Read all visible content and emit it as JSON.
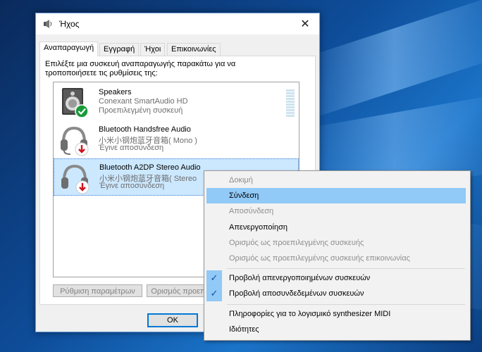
{
  "window": {
    "title": "Ήχος",
    "close_glyph": "✕"
  },
  "tabs": [
    {
      "label": "Αναπαραγωγή",
      "active": true
    },
    {
      "label": "Εγγραφή",
      "active": false
    },
    {
      "label": "Ήχοι",
      "active": false
    },
    {
      "label": "Επικοινωνίες",
      "active": false
    }
  ],
  "instructions": "Επιλέξτε μια συσκευή αναπαραγωγής παρακάτω για να τροποποιήσετε τις ρυθμίσεις της:",
  "devices": [
    {
      "name": "Speakers",
      "driver": "Conexant SmartAudio HD",
      "status": "Προεπιλεγμένη συσκευή",
      "icon": "speaker-icon",
      "badge": "check-badge-icon",
      "badge_color": "#1a9b3a"
    },
    {
      "name": "Bluetooth Handsfree Audio",
      "driver": "小米小钢炮蓝牙音箱( Mono )",
      "status": "Έγινε αποσύνδεση",
      "icon": "headset-icon",
      "badge": "down-arrow-badge-icon",
      "badge_color": "#d0121b"
    },
    {
      "name": "Bluetooth A2DP Stereo Audio",
      "driver": "小米小钢炮蓝牙音箱( Stereo",
      "status": "Έγινε αποσύνδεση",
      "icon": "headset-icon",
      "badge": "down-arrow-badge-icon",
      "badge_color": "#d0121b"
    }
  ],
  "buttons": {
    "configure": "Ρύθμιση παραμέτρων",
    "set_default": "Ορισμός προεπ",
    "ok": "OK"
  },
  "context_menu": {
    "items": [
      {
        "label": "Δοκιμή",
        "disabled": true
      },
      {
        "label": "Σύνδεση",
        "hover": true
      },
      {
        "label": "Αποσύνδεση",
        "disabled": true
      },
      {
        "label": "Απενεργοποίηση"
      },
      {
        "label": "Ορισμός ως προεπιλεγμένης συσκευής",
        "disabled": true
      },
      {
        "label": "Ορισμός ως προεπιλεγμένης συσκευής επικοινωνίας",
        "disabled": true
      },
      {
        "label": "Προβολή απενεργοποιημένων συσκευών",
        "checked": true
      },
      {
        "label": "Προβολή αποσυνδεδεμένων συσκευών",
        "checked": true
      },
      {
        "label": "Πληροφορίες για το λογισμικό synthesizer MIDI"
      },
      {
        "label": "Ιδιότητες"
      }
    ],
    "check_glyph": "✓"
  },
  "colors": {
    "accent": "#0078d7",
    "selection": "#cce8ff",
    "menu_hover": "#91c9f7"
  }
}
